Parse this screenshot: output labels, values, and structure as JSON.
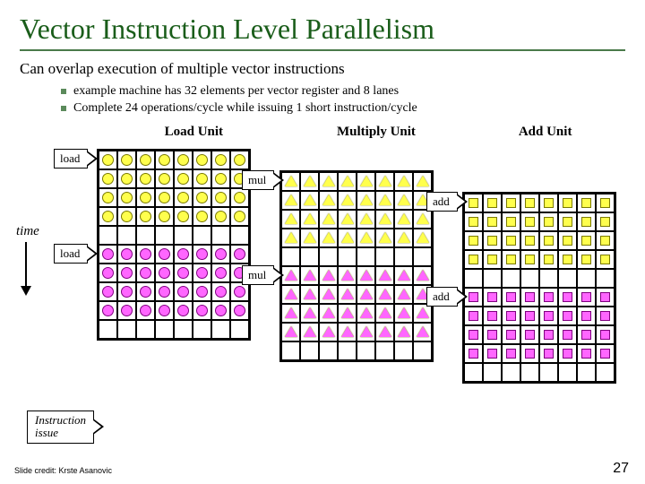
{
  "title": "Vector Instruction Level Parallelism",
  "intro": "Can overlap execution of multiple vector instructions",
  "bullets": [
    "example machine has 32 elements per vector register and 8 lanes",
    "Complete 24 operations/cycle while issuing 1 short instruction/cycle"
  ],
  "units": {
    "load": "Load Unit",
    "mul": "Multiply Unit",
    "add": "Add Unit"
  },
  "labels": {
    "load1": "load",
    "load2": "load",
    "mul1": "mul",
    "mul2": "mul",
    "add1": "add",
    "add2": "add",
    "time": "time",
    "instruction_issue": "Instruction\nissue"
  },
  "grid": {
    "cols": 8,
    "rows": 10
  },
  "credit": "Slide credit: Krste Asanovic",
  "page": "27"
}
